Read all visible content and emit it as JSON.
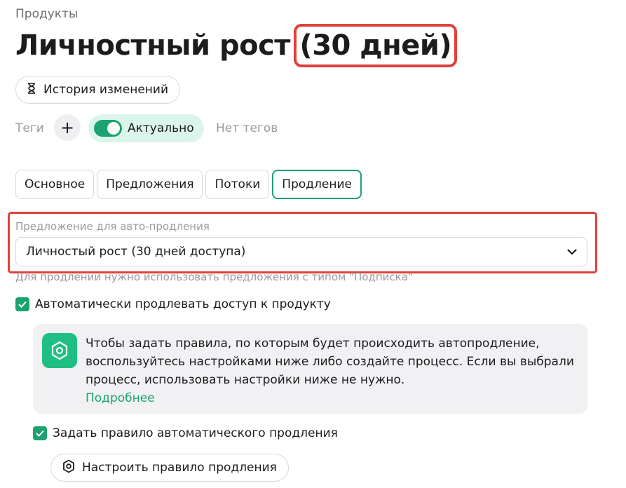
{
  "breadcrumb": "Продукты",
  "title": {
    "main": "Личностный рост ",
    "highlight": "(30 дней)"
  },
  "history_button": "История изменений",
  "tags": {
    "label": "Теги",
    "add": "+",
    "status_label": "Актуально",
    "status_on": true,
    "empty": "Нет тегов"
  },
  "tabs": [
    {
      "label": "Основное"
    },
    {
      "label": "Предложения"
    },
    {
      "label": "Потоки"
    },
    {
      "label": "Продление"
    }
  ],
  "active_tab": "Продление",
  "autorenew": {
    "field_label": "Предложение для авто-продления",
    "selected": "Личностый рост (30 дней доступа)",
    "hint": "Для продлении нужно использовать предложения с типом \"Подписка\""
  },
  "auto_extend": {
    "label": "Автоматически продлевать доступ к продукту",
    "checked": true
  },
  "info": {
    "text": "Чтобы задать правила, по которым будет происходить автопродление, воспользуйтесь настройками ниже либо создайте процесс. Если вы выбрали процесс, использовать настройки ниже не нужно.",
    "link": "Подробнее"
  },
  "set_rule": {
    "label": "Задать правило автоматического продления",
    "checked": true
  },
  "configure_button": "Настроить правило продления",
  "colors": {
    "accent": "#1aa36f",
    "highlight": "#e0403a"
  }
}
